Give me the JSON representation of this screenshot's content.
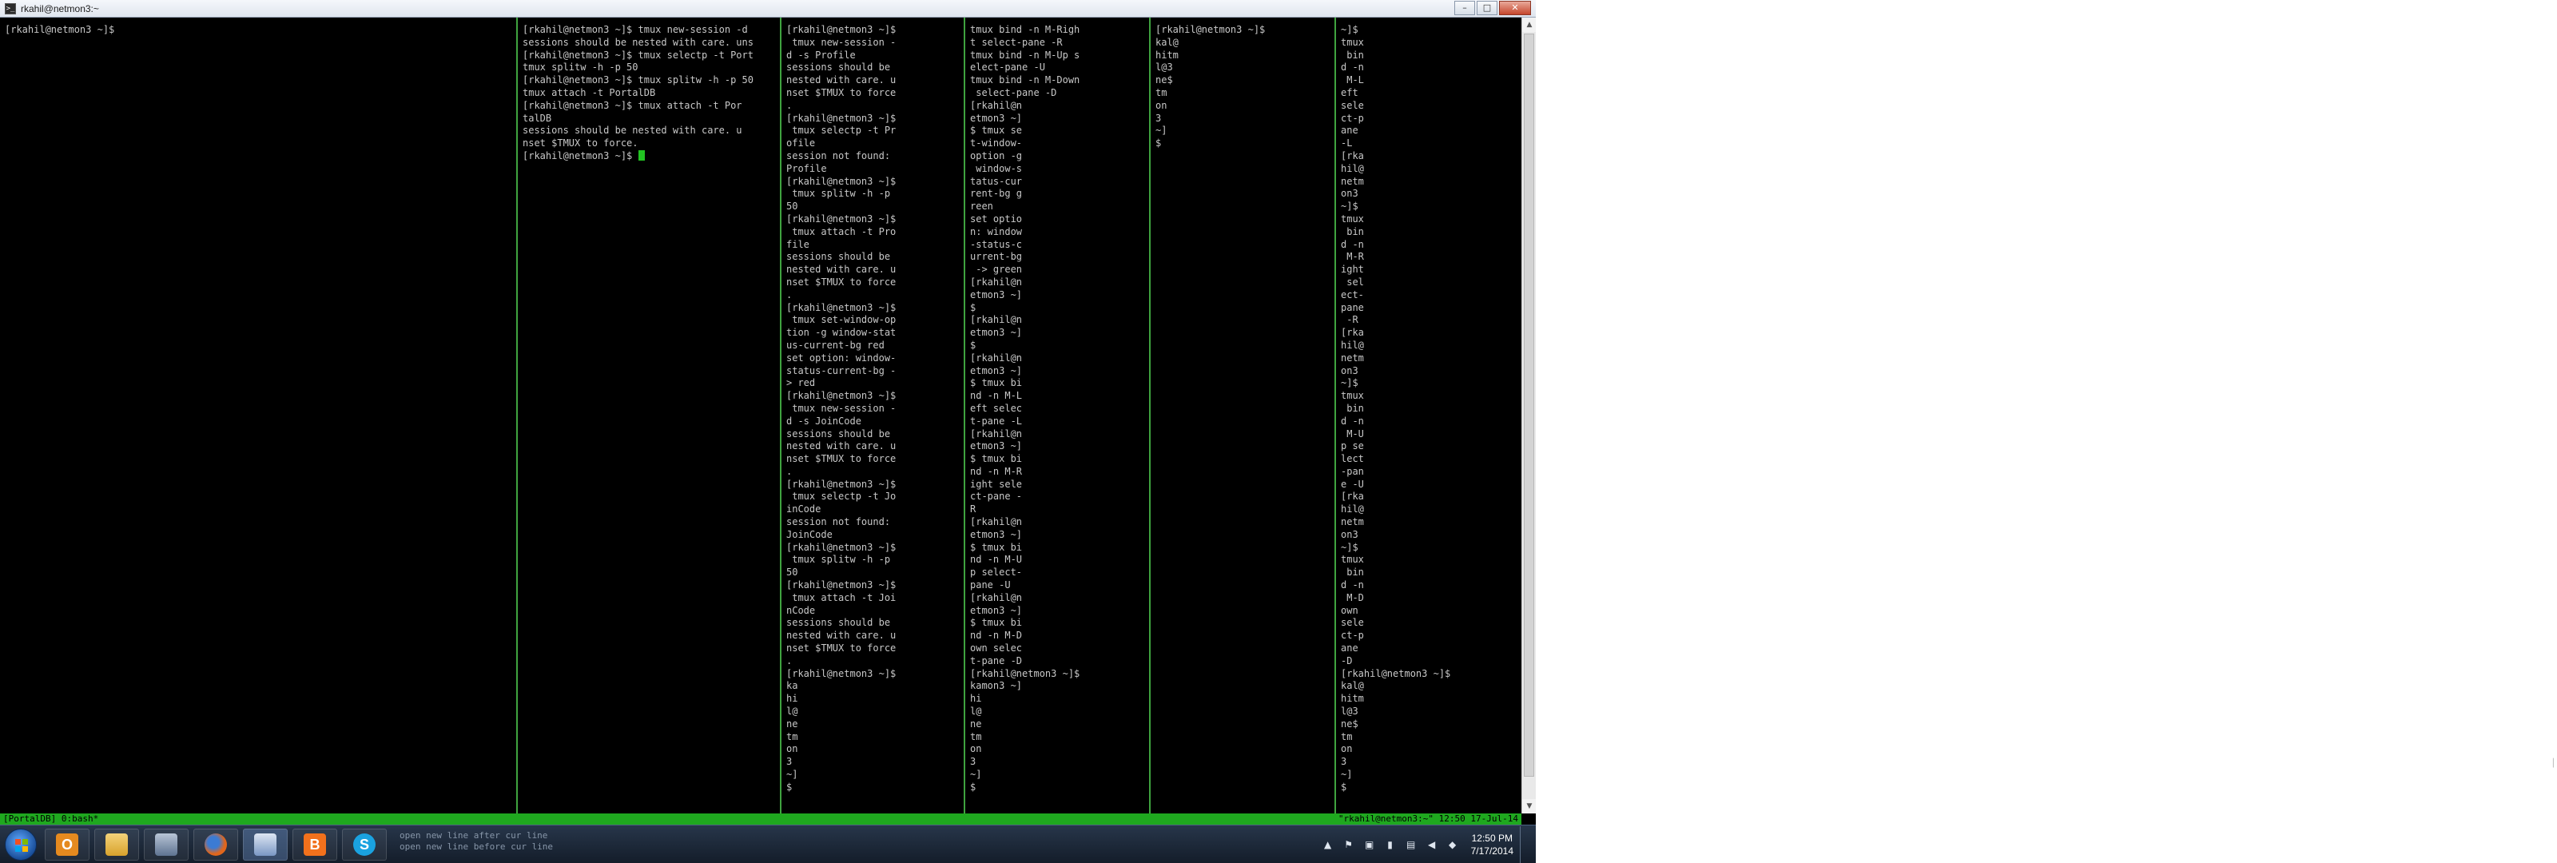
{
  "window": {
    "title": "rkahil@netmon3:~",
    "icon_label": ">_",
    "controls": [
      "–",
      "□",
      "✕"
    ]
  },
  "panes": [
    {
      "lines": "[rkahil@netmon3 ~]$"
    },
    {
      "lines": "[rkahil@netmon3 ~]$ tmux new-session -d\nsessions should be nested with care. uns\n[rkahil@netmon3 ~]$ tmux selectp -t Port\ntmux splitw -h -p 50\n[rkahil@netmon3 ~]$ tmux splitw -h -p 50\ntmux attach -t PortalDB\n[rkahil@netmon3 ~]$ tmux attach -t Por\ntalDB\nsessions should be nested with care. u\nnset $TMUX to force.\n[rkahil@netmon3 ~]$ "
    },
    {
      "lines": "[rkahil@netmon3 ~]$\n tmux new-session -\nd -s Profile\nsessions should be\nnested with care. u\nnset $TMUX to force\n.\n[rkahil@netmon3 ~]$\n tmux selectp -t Pr\nofile\nsession not found:\nProfile\n[rkahil@netmon3 ~]$\n tmux splitw -h -p\n50\n[rkahil@netmon3 ~]$\n tmux attach -t Pro\nfile\nsessions should be\nnested with care. u\nnset $TMUX to force\n.\n[rkahil@netmon3 ~]$\n tmux set-window-op\ntion -g window-stat\nus-current-bg red\nset option: window-\nstatus-current-bg -\n> red\n[rkahil@netmon3 ~]$\n tmux new-session -\nd -s JoinCode\nsessions should be\nnested with care. u\nnset $TMUX to force\n.\n[rkahil@netmon3 ~]$\n tmux selectp -t Jo\ninCode\nsession not found:\nJoinCode\n[rkahil@netmon3 ~]$\n tmux splitw -h -p\n50\n[rkahil@netmon3 ~]$\n tmux attach -t Joi\nnCode\nsessions should be\nnested with care. u\nnset $TMUX to force\n.\n[rkahil@netmon3 ~]$\nka\nhi\nl@\nne\ntm\non\n3\n~]\n$"
    },
    {
      "lines": "tmux bind -n M-Righ\nt select-pane -R\ntmux bind -n M-Up s\nelect-pane -U\ntmux bind -n M-Down\n select-pane -D\n[rkahil@n\netmon3 ~]\n$ tmux se\nt-window-\noption -g\n window-s\ntatus-cur\nrent-bg g\nreen\nset optio\nn: window\n-status-c\nurrent-bg\n -> green\n[rkahil@n\netmon3 ~]\n$\n[rkahil@n\netmon3 ~]\n$\n[rkahil@n\netmon3 ~]\n$ tmux bi\nnd -n M-L\neft selec\nt-pane -L\n[rkahil@n\netmon3 ~]\n$ tmux bi\nnd -n M-R\night sele\nct-pane -\nR\n[rkahil@n\netmon3 ~]\n$ tmux bi\nnd -n M-U\np select-\npane -U\n[rkahil@n\netmon3 ~]\n$ tmux bi\nnd -n M-D\nown selec\nt-pane -D\n[rkahil@netmon3 ~]$\nkamon3 ~]\nhi\nl@\nne\ntm\non\n3\n~]\n$"
    },
    {
      "lines": "[rkahil@netmon3 ~]$\nkal@\nhitm\nl@3\nne$\ntm\non\n3\n~]\n$"
    },
    {
      "lines": "~]$\ntmux\n bin\nd -n\n M-L\neft\nsele\nct-p\nane\n-L\n[rka\nhil@\nnetm\non3\n~]$\ntmux\n bin\nd -n\n M-R\night\n sel\nect-\npane\n -R\n[rka\nhil@\nnetm\non3\n~]$\ntmux\n bin\nd -n\n M-U\np se\nlect\n-pan\ne -U\n[rka\nhil@\nnetm\non3\n~]$\ntmux\n bin\nd -n\n M-D\nown\nsele\nct-p\nane\n-D\n[rkahil@netmon3 ~]$\nkal@\nhitm\nl@3\nne$\ntm\non\n3\n~]\n$"
    }
  ],
  "statusbar": {
    "left": "[PortalDB] 0:bash*",
    "right": "\"rkahil@netmon3:~\" 12:50 17-Jul-14"
  },
  "taskbar": {
    "apps": [
      {
        "name": "outlook",
        "color": "#e58a1f",
        "label": "O"
      },
      {
        "name": "explorer",
        "color": "#e8b53a",
        "label": ""
      },
      {
        "name": "network-tool",
        "color": "#6f86a6",
        "label": ""
      },
      {
        "name": "firefox",
        "color": "#e0661c",
        "label": ""
      },
      {
        "name": "notepad",
        "color": "#5a8fd0",
        "label": ""
      },
      {
        "name": "blogger",
        "color": "#f2711c",
        "label": "B"
      },
      {
        "name": "skype",
        "color": "#1aa2e0",
        "label": "S"
      }
    ],
    "ghost_text_1": "open new line after cur line",
    "ghost_text_2": "open new line before cur line",
    "clock_time": "12:50 PM",
    "clock_date": "7/17/2014"
  }
}
